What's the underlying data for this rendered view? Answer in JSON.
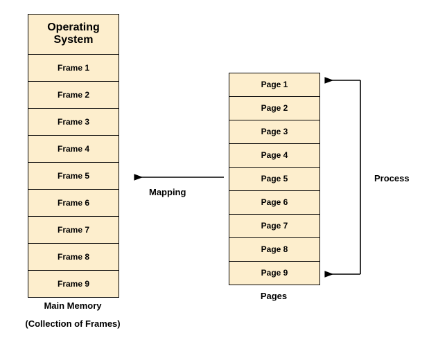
{
  "memory": {
    "header": "Operating System",
    "frames": [
      "Frame 1",
      "Frame 2",
      "Frame 3",
      "Frame 4",
      "Frame 5",
      "Frame 6",
      "Frame 7",
      "Frame 8",
      "Frame 9"
    ],
    "caption_line1": "Main Memory",
    "caption_line2": "(Collection of Frames)"
  },
  "pages": {
    "items": [
      "Page 1",
      "Page 2",
      "Page 3",
      "Page 4",
      "Page 5",
      "Page 6",
      "Page 7",
      "Page 8",
      "Page 9"
    ],
    "caption": "Pages"
  },
  "labels": {
    "mapping": "Mapping",
    "process": "Process"
  },
  "colors": {
    "fill": "#fdeecd",
    "stroke": "#000000"
  }
}
